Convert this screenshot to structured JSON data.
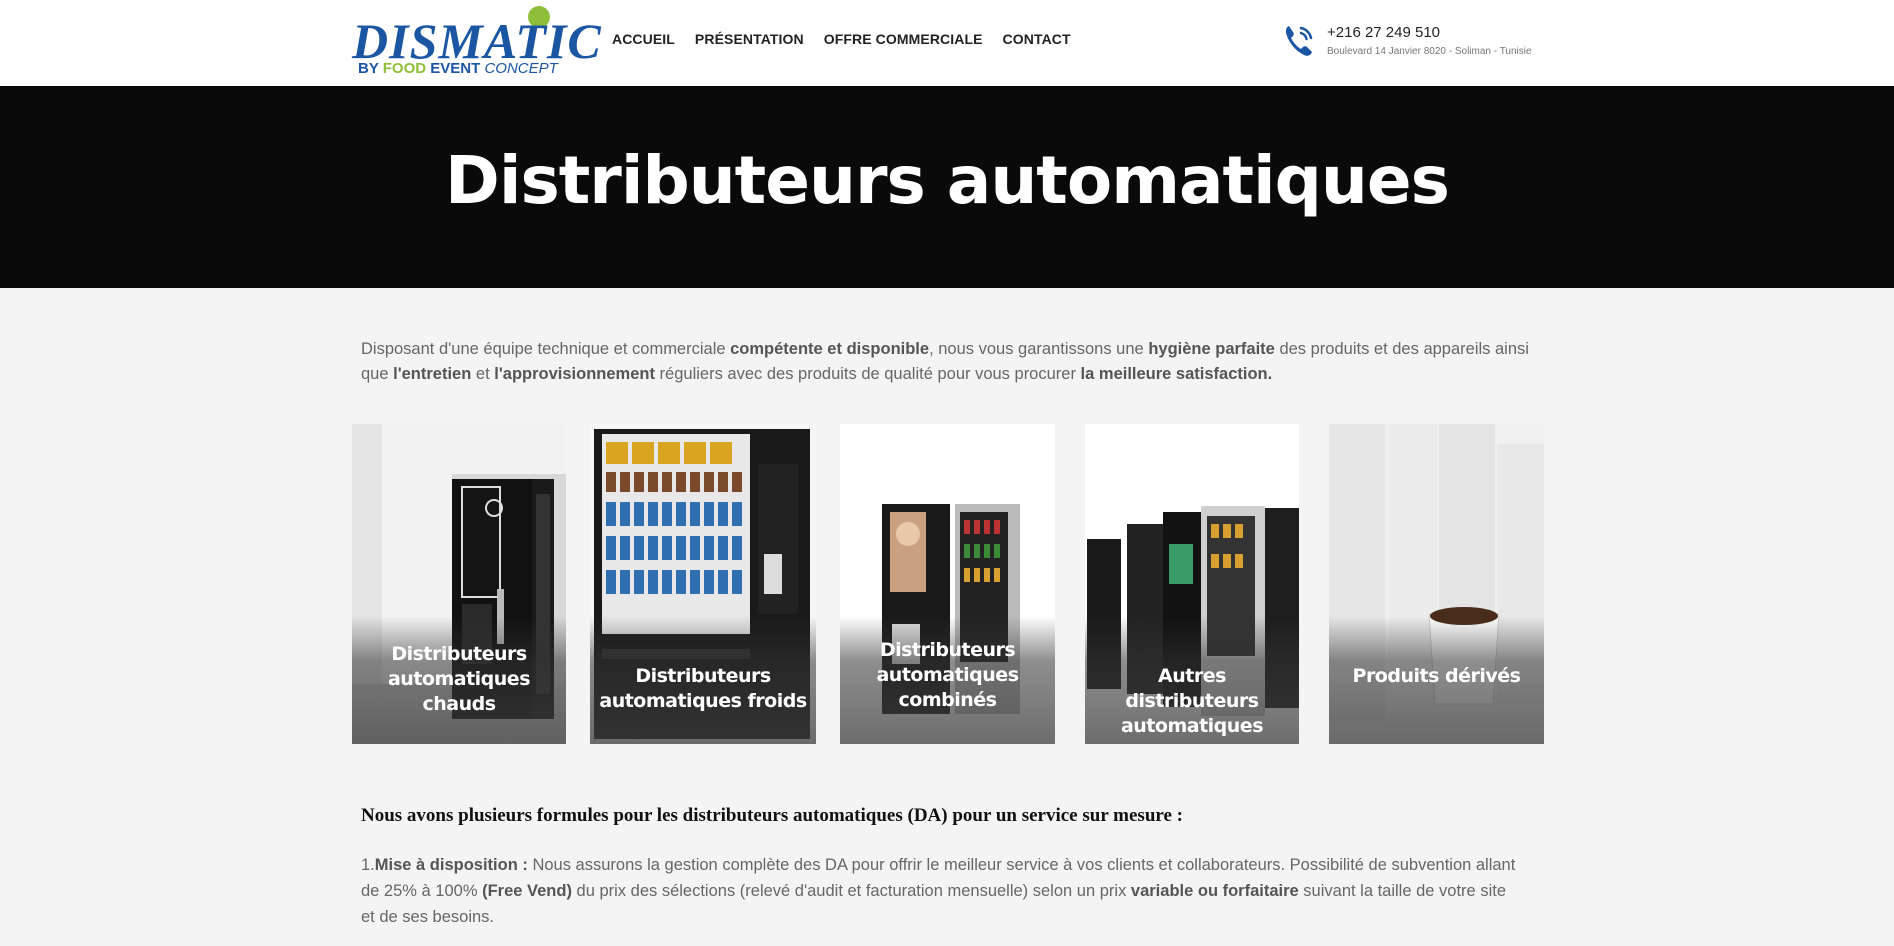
{
  "header": {
    "logo": {
      "main": "DISMATIC",
      "sub_by": "BY",
      "sub_food": "FOOD",
      "sub_event": "EVENT",
      "sub_concept": "CONCEPT"
    },
    "nav": [
      "ACCUEIL",
      "PRÉSENTATION",
      "OFFRE COMMERCIALE",
      "CONTACT"
    ],
    "contact": {
      "icon": "phone-icon",
      "phone": "+216 27 249 510",
      "address": "Boulevard 14 Janvier 8020 - Soliman - Tunisie"
    }
  },
  "hero": {
    "title": "Distributeurs automatiques"
  },
  "intro": {
    "t1": "Disposant d'une équipe technique et commerciale ",
    "b1": "compétente et disponible",
    "t2": ", nous vous garantissons une ",
    "b2": "hygiène parfaite",
    "t3": " des produits et des appareils ainsi que ",
    "b3": "l'entretien",
    "t4": " et ",
    "b4": "l'approvisionnement",
    "t5": " réguliers avec des produits de qualité pour vous procurer ",
    "b5": "la meilleure satisfaction."
  },
  "cards": [
    {
      "label": "Distributeurs automatiques chauds"
    },
    {
      "label": "Distributeurs automatiques froids"
    },
    {
      "label": "Distributeurs automatiques combinés"
    },
    {
      "label": "Autres distributeurs automatiques"
    },
    {
      "label": "Produits dérivés"
    }
  ],
  "formules": {
    "heading": "Nous avons plusieurs formules pour les distributeurs automatiques (DA) pour un service sur mesure :",
    "p1": {
      "num": "1.",
      "b1": "Mise à disposition :",
      "t1": " Nous assurons la gestion complète des DA pour offrir le meilleur service à vos clients et collaborateurs. Possibilité de subvention allant de 25% à 100% ",
      "b2": "(Free Vend)",
      "t2": " du prix des sélections (relevé d'audit et facturation mensuelle) selon un prix ",
      "b3": "variable ou forfaitaire",
      "t3": " suivant la taille de votre site et de ses besoins."
    }
  },
  "colors": {
    "brand_blue": "#1b56a3",
    "brand_green": "#8fbf3a",
    "hero_bg": "#0a0a0a",
    "page_bg": "#f4f4f4"
  }
}
